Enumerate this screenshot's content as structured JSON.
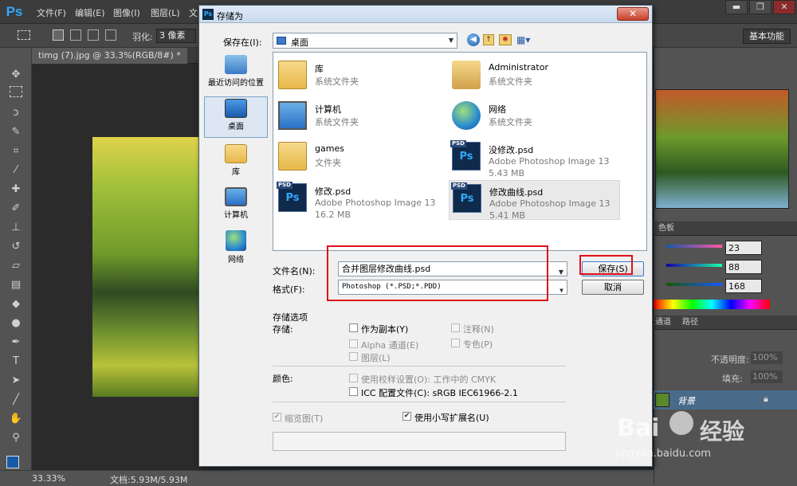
{
  "app": {
    "logo": "Ps",
    "menus": [
      "文件(F)",
      "编辑(E)",
      "图像(I)",
      "图层(L)",
      "文"
    ],
    "window_buttons": [
      "▬",
      "❐",
      "✕"
    ],
    "options": {
      "feather_label": "羽化:",
      "feather_value": "3 像素"
    },
    "workspace": "基本功能",
    "doc_tab": "timg (7).jpg @ 33.3%(RGB/8#) *",
    "status": {
      "zoom": "33.33%",
      "doc": "文档:5.93M/5.93M"
    }
  },
  "right_panel": {
    "color_head": "色板",
    "r": "23",
    "g": "88",
    "b": "168",
    "channels_tab": "通道",
    "paths_tab": "路径",
    "opacity_label": "不透明度:",
    "opacity_value": "100%",
    "fill_label": "填充:",
    "fill_value": "100%",
    "layer_name": "背景"
  },
  "dialog": {
    "title": "存储为",
    "close": "✕",
    "save_in_label": "保存在(I):",
    "save_in_value": "桌面",
    "places": [
      {
        "label": "最近访问的位置",
        "icon": "recent-places-icon"
      },
      {
        "label": "桌面",
        "icon": "desktop-icon"
      },
      {
        "label": "库",
        "icon": "libraries-icon"
      },
      {
        "label": "计算机",
        "icon": "computer-icon"
      },
      {
        "label": "网络",
        "icon": "network-icon"
      }
    ],
    "files": [
      {
        "name": "库",
        "sub1": "系统文件夹",
        "sub2": "",
        "icon": "libraries-icon"
      },
      {
        "name": "Administrator",
        "sub1": "系统文件夹",
        "sub2": "",
        "icon": "user-folder-icon"
      },
      {
        "name": "计算机",
        "sub1": "系统文件夹",
        "sub2": "",
        "icon": "computer-icon"
      },
      {
        "name": "网络",
        "sub1": "系统文件夹",
        "sub2": "",
        "icon": "network-icon"
      },
      {
        "name": "games",
        "sub1": "文件夹",
        "sub2": "",
        "icon": "folder-icon"
      },
      {
        "name": "没修改.psd",
        "sub1": "Adobe Photoshop Image 13",
        "sub2": "5.43 MB",
        "icon": "psd-file-icon"
      },
      {
        "name": "修改.psd",
        "sub1": "Adobe Photoshop Image 13",
        "sub2": "16.2 MB",
        "icon": "psd-file-icon"
      },
      {
        "name": "修改曲线.psd",
        "sub1": "Adobe Photoshop Image 13",
        "sub2": "5.41 MB",
        "icon": "psd-file-icon"
      }
    ],
    "filename_label": "文件名(N):",
    "filename_value": "合并图层修改曲线.psd",
    "format_label": "格式(F):",
    "format_value": "Photoshop (*.PSD;*.PDD)",
    "save_button": "保存(S)",
    "cancel_button": "取消",
    "options_title": "存储选项",
    "storage_label": "存储:",
    "opt_copy": "作为副本(Y)",
    "opt_alpha": "Alpha 通道(E)",
    "opt_layers": "图层(L)",
    "opt_notes": "注释(N)",
    "opt_spot": "专色(P)",
    "color_label": "颜色:",
    "opt_proof": "使用校样设置(O):  工作中的 CMYK",
    "opt_icc": "ICC 配置文件(C):  sRGB IEC61966-2.1",
    "opt_thumb": "缩览图(T)",
    "opt_lowercase": "使用小写扩展名(U)"
  },
  "watermark": {
    "brand": "Bai",
    "brand2": "经验",
    "url": "jingyan.baidu.com"
  }
}
